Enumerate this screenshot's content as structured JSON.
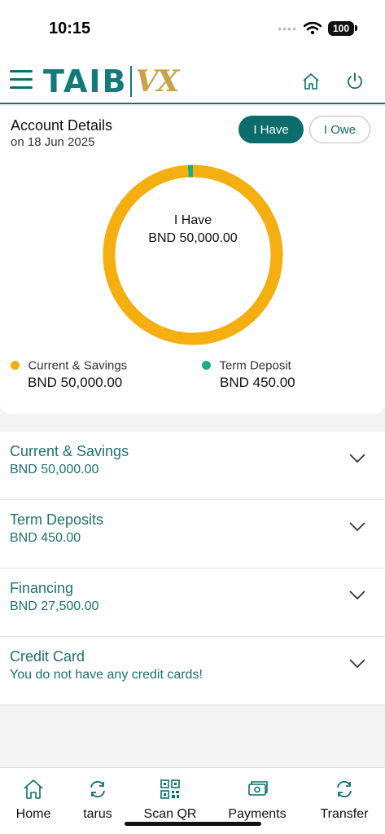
{
  "status_bar": {
    "time": "10:15",
    "battery": "100"
  },
  "header": {
    "logo_main": "TAIB",
    "logo_accent": "VX"
  },
  "account": {
    "title": "Account Details",
    "date": "on 18 Jun 2025",
    "toggle_have": "I Have",
    "toggle_owe": "I Owe",
    "center_label": "I Have",
    "center_amount": "BND 50,000.00",
    "legend": [
      {
        "label": "Current & Savings",
        "amount": "BND 50,000.00",
        "color": "#f5ae0f"
      },
      {
        "label": "Term Deposit",
        "amount": "BND 450.00",
        "color": "#1faa8c"
      }
    ]
  },
  "chart_data": {
    "type": "pie",
    "categories": [
      "Current & Savings",
      "Term Deposit"
    ],
    "values": [
      50000,
      450
    ],
    "colors": [
      "#f5ae0f",
      "#1faa8c"
    ],
    "donut": true
  },
  "accounts_list": [
    {
      "title": "Current & Savings",
      "subtitle": "BND 50,000.00"
    },
    {
      "title": "Term Deposits",
      "subtitle": "BND 450.00"
    },
    {
      "title": "Financing",
      "subtitle": "BND 27,500.00"
    },
    {
      "title": "Credit Card",
      "subtitle": "You do not have any credit cards!"
    }
  ],
  "bottom_nav": [
    {
      "label": "Home",
      "icon": "home-icon"
    },
    {
      "label": "tarus",
      "icon": "transfer-cycle-icon"
    },
    {
      "label": "Scan QR",
      "icon": "qr-code-icon"
    },
    {
      "label": "Payments",
      "icon": "payments-icon"
    },
    {
      "label": "Transfer",
      "icon": "transfer-icon"
    }
  ]
}
